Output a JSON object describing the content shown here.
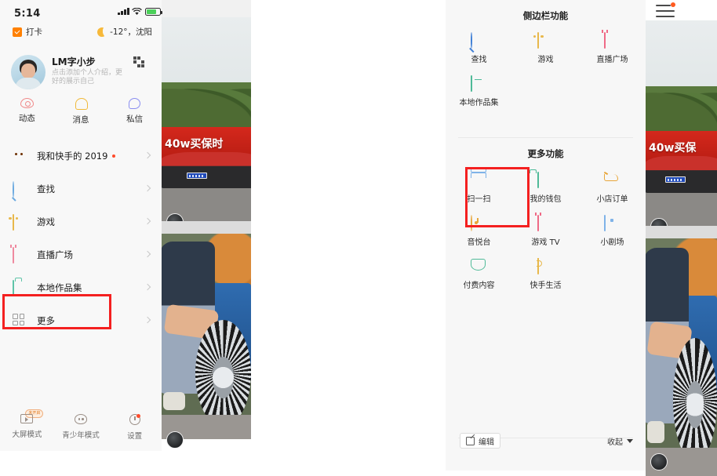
{
  "left_phone": {
    "status_bar": {
      "time": "5:14",
      "signal_icon": "cellular-signal-icon",
      "wifi_icon": "wifi-icon",
      "battery_icon": "battery-icon"
    },
    "check_in": {
      "label": "打卡",
      "icon": "checkbox-checked-icon"
    },
    "weather": {
      "text": "-12°，沈阳",
      "icon": "moon-icon"
    },
    "profile": {
      "username": "LM字小步",
      "bio": "点击添加个人介绍，更好的展示自己",
      "qr_icon": "qr-code-icon",
      "avatar": "user-avatar"
    },
    "quick_tabs": [
      {
        "label": "动态",
        "icon": "eye-icon"
      },
      {
        "label": "消息",
        "icon": "bell-icon"
      },
      {
        "label": "私信",
        "icon": "chat-bubble-icon"
      }
    ],
    "menu": [
      {
        "label": "我和快手的 2019",
        "icon": "pumpkin-icon",
        "dot": true
      },
      {
        "label": "查找",
        "icon": "search-icon",
        "dot": false
      },
      {
        "label": "游戏",
        "icon": "game-controller-icon",
        "dot": false
      },
      {
        "label": "直播广场",
        "icon": "live-tv-icon",
        "dot": false
      },
      {
        "label": "本地作品集",
        "icon": "folder-icon",
        "dot": false
      },
      {
        "label": "更多",
        "icon": "grid-icon",
        "dot": false
      }
    ],
    "bottom_bar": [
      {
        "label": "大屏模式",
        "icon": "tv-icon",
        "badge": "未开启"
      },
      {
        "label": "青少年模式",
        "icon": "teen-face-icon",
        "badge": ""
      },
      {
        "label": "设置",
        "icon": "gear-icon",
        "badge": ""
      }
    ],
    "video": {
      "banner_text": "40w买保时",
      "menu_icon": "hamburger-menu-icon"
    }
  },
  "right_phone": {
    "section_sidebar": {
      "title": "侧边栏功能",
      "items": [
        {
          "label": "查找",
          "icon": "search-icon"
        },
        {
          "label": "游戏",
          "icon": "game-controller-icon"
        },
        {
          "label": "直播广场",
          "icon": "live-tv-icon"
        },
        {
          "label": "本地作品集",
          "icon": "folder-icon"
        }
      ]
    },
    "section_more": {
      "title": "更多功能",
      "items": [
        {
          "label": "扫一扫",
          "icon": "scan-icon"
        },
        {
          "label": "我的钱包",
          "icon": "wallet-icon"
        },
        {
          "label": "小店订单",
          "icon": "shopping-cart-icon"
        },
        {
          "label": "音悦台",
          "icon": "music-icon"
        },
        {
          "label": "游戏 TV",
          "icon": "game-tv-icon"
        },
        {
          "label": "小剧场",
          "icon": "theater-screen-icon"
        },
        {
          "label": "付费内容",
          "icon": "diamond-icon"
        },
        {
          "label": "快手生活",
          "icon": "cup-icon"
        }
      ]
    },
    "footer": {
      "edit_label": "编辑",
      "edit_icon": "edit-icon",
      "collapse_label": "收起",
      "collapse_icon": "caret-down-icon"
    },
    "video": {
      "banner_text": "40w买保",
      "menu_icon": "hamburger-menu-icon"
    }
  },
  "highlight_color": "#f42020"
}
